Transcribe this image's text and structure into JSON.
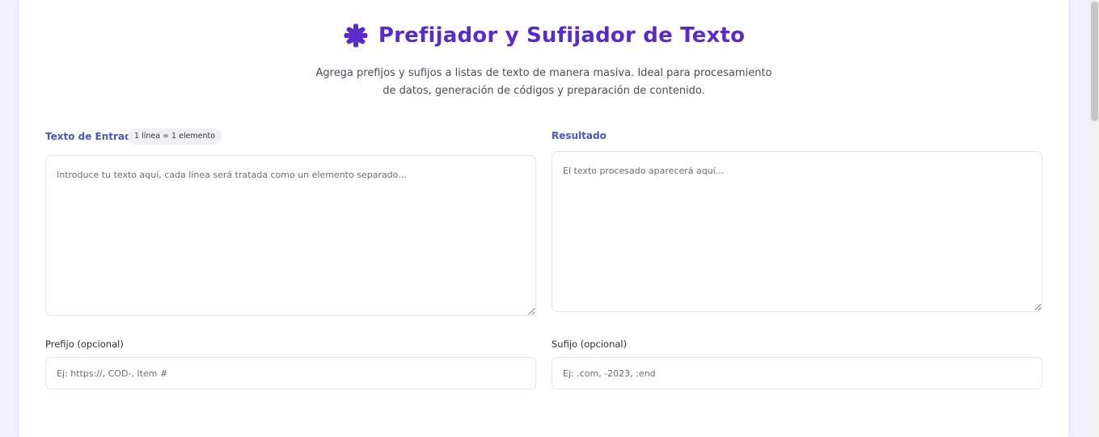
{
  "header": {
    "title": "Prefijador y Sufijador de Texto",
    "subtitle": "Agrega prefijos y sufijos a listas de texto de manera masiva. Ideal para procesamiento de datos, generación de códigos y preparación de contenido.",
    "icon": "puzzle-piece-icon",
    "accent_color": "#5b2bc9"
  },
  "input": {
    "label": "Texto de Entrada",
    "badge": "1 línea = 1 elemento",
    "placeholder": "Introduce tu texto aquí, cada línea será tratada como un elemento separado...",
    "value": ""
  },
  "output": {
    "label": "Resultado",
    "placeholder": "El texto procesado aparecerá aquí...",
    "value": ""
  },
  "prefix": {
    "label": "Prefijo (opcional)",
    "placeholder": "Ej: https://, COD-, Item #",
    "value": ""
  },
  "suffix": {
    "label": "Sufijo (opcional)",
    "placeholder": "Ej: .com, -2023, :end",
    "value": ""
  }
}
